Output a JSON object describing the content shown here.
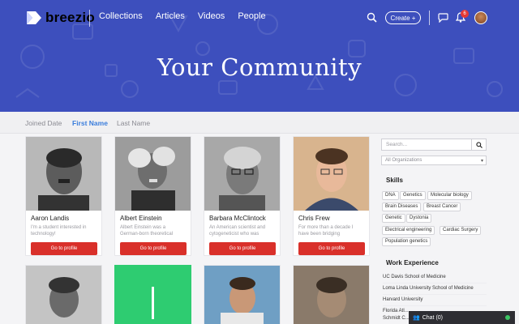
{
  "nav": {
    "logo_text": "breezio",
    "links": [
      "Collections",
      "Articles",
      "Videos",
      "People"
    ],
    "create_label": "Create +",
    "notification_count": "6",
    "icons": [
      "search-icon",
      "chat-icon",
      "bell-icon"
    ]
  },
  "hero": {
    "title": "Your Community",
    "bg_color": "#3d4fbd"
  },
  "sort": {
    "options": [
      "Joined Date",
      "First Name",
      "Last Name"
    ],
    "active": "First Name"
  },
  "people": [
    {
      "name": "Aaron Landis",
      "desc": "I'm a student interested in technology!",
      "button": "Go to profile"
    },
    {
      "name": "Albert Einstein",
      "desc": "Albert Einstein was a German-born theoretical physicist.",
      "button": "Go to profile"
    },
    {
      "name": "Barbara McClintock",
      "desc": "An American scientist and cytogeneticist who was",
      "button": "Go to profile"
    },
    {
      "name": "Chris Frew",
      "desc": "For more than a decade I have been bridging connections",
      "button": "Go to profile"
    }
  ],
  "sidebar": {
    "search_placeholder": "Search...",
    "org_select": "All Organizations",
    "skills_heading": "Skills",
    "skills": [
      "DNA",
      "Genetics",
      "Molecular biology",
      "Brain Diseases",
      "Breast Cancer",
      "Genetic",
      "Dystonia",
      "Electrical engineering",
      "Cardiac Surgery",
      "Population genetics"
    ],
    "work_heading": "Work Experience",
    "work": [
      "UC Davis School of Medicine",
      "Loma Linda University School of Medicine",
      "Harvard University",
      "Florida Atl...",
      "Schmidt C..."
    ]
  },
  "chat": {
    "label": "Chat (0)"
  },
  "colors": {
    "accent_red": "#d9302a",
    "accent_blue": "#3a7ddc",
    "green_tile": "#2ecc71"
  }
}
